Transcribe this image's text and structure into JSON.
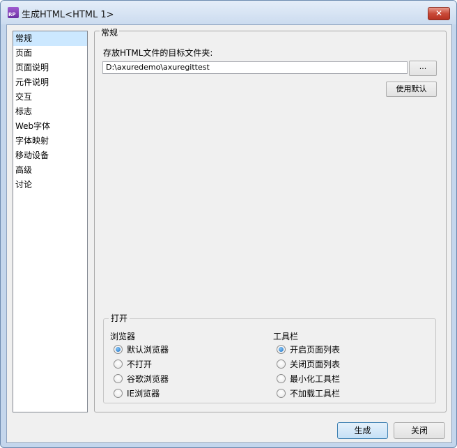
{
  "window": {
    "title": "生成HTML<HTML 1>",
    "icon_text": "RP",
    "close_glyph": "✕"
  },
  "nav": {
    "items": [
      {
        "label": "常规",
        "selected": true
      },
      {
        "label": "页面"
      },
      {
        "label": "页面说明"
      },
      {
        "label": "元件说明"
      },
      {
        "label": "交互"
      },
      {
        "label": "标志"
      },
      {
        "label": "Web字体"
      },
      {
        "label": "字体映射"
      },
      {
        "label": "移动设备"
      },
      {
        "label": "高级"
      },
      {
        "label": "讨论"
      }
    ]
  },
  "general": {
    "legend": "常规",
    "dir_label": "存放HTML文件的目标文件夹:",
    "dir_value": "D:\\axuredemo\\axuregittest",
    "browse_label": "...",
    "default_label": "使用默认"
  },
  "open": {
    "legend": "打开",
    "browser_heading": "浏览器",
    "toolbar_heading": "工具栏",
    "browser_options": [
      {
        "label": "默认浏览器",
        "checked": true
      },
      {
        "label": "不打开",
        "checked": false
      },
      {
        "label": "谷歌浏览器",
        "checked": false
      },
      {
        "label": "IE浏览器",
        "checked": false
      }
    ],
    "toolbar_options": [
      {
        "label": "开启页面列表",
        "checked": true
      },
      {
        "label": "关闭页面列表",
        "checked": false
      },
      {
        "label": "最小化工具栏",
        "checked": false
      },
      {
        "label": "不加载工具栏",
        "checked": false
      }
    ]
  },
  "footer": {
    "generate_label": "生成",
    "close_label": "关闭"
  }
}
